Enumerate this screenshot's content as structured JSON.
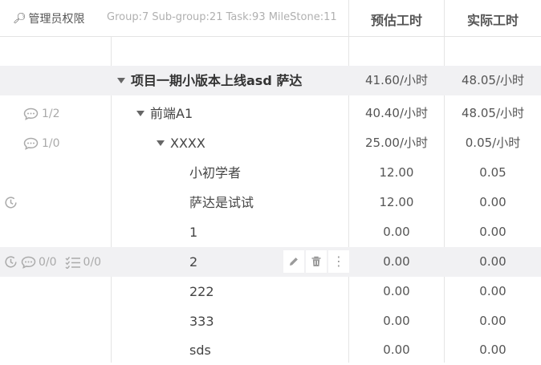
{
  "header": {
    "permission_label": "管理员权限",
    "stats": "Group:7 Sub-group:21 Task:93 MileStone:11",
    "col_estimate": "预估工时",
    "col_actual": "实际工时"
  },
  "rows": [
    {
      "name": "项目一期小版本上线asd 萨达",
      "estimate": "41.60/小时",
      "actual": "48.05/小时"
    },
    {
      "name": "前端A1",
      "estimate": "40.40/小时",
      "actual": "48.05/小时",
      "comments": "1/2"
    },
    {
      "name": "XXXX",
      "estimate": "25.00/小时",
      "actual": "0.05/小时",
      "comments": "1/0"
    },
    {
      "name": "小初学者",
      "estimate": "12.00",
      "actual": "0.05"
    },
    {
      "name": "萨达是试试",
      "estimate": "12.00",
      "actual": "0.00"
    },
    {
      "name": "1",
      "estimate": "0.00",
      "actual": "0.00"
    },
    {
      "name": "2",
      "estimate": "0.00",
      "actual": "0.00",
      "comments": "0/0",
      "checklist": "0/0"
    },
    {
      "name": "222",
      "estimate": "0.00",
      "actual": "0.00"
    },
    {
      "name": "333",
      "estimate": "0.00",
      "actual": "0.00"
    },
    {
      "name": "sds",
      "estimate": "0.00",
      "actual": "0.00"
    }
  ],
  "colors": {
    "highlight_row": "#f1f1f3",
    "muted_text": "#b0b0b0"
  }
}
